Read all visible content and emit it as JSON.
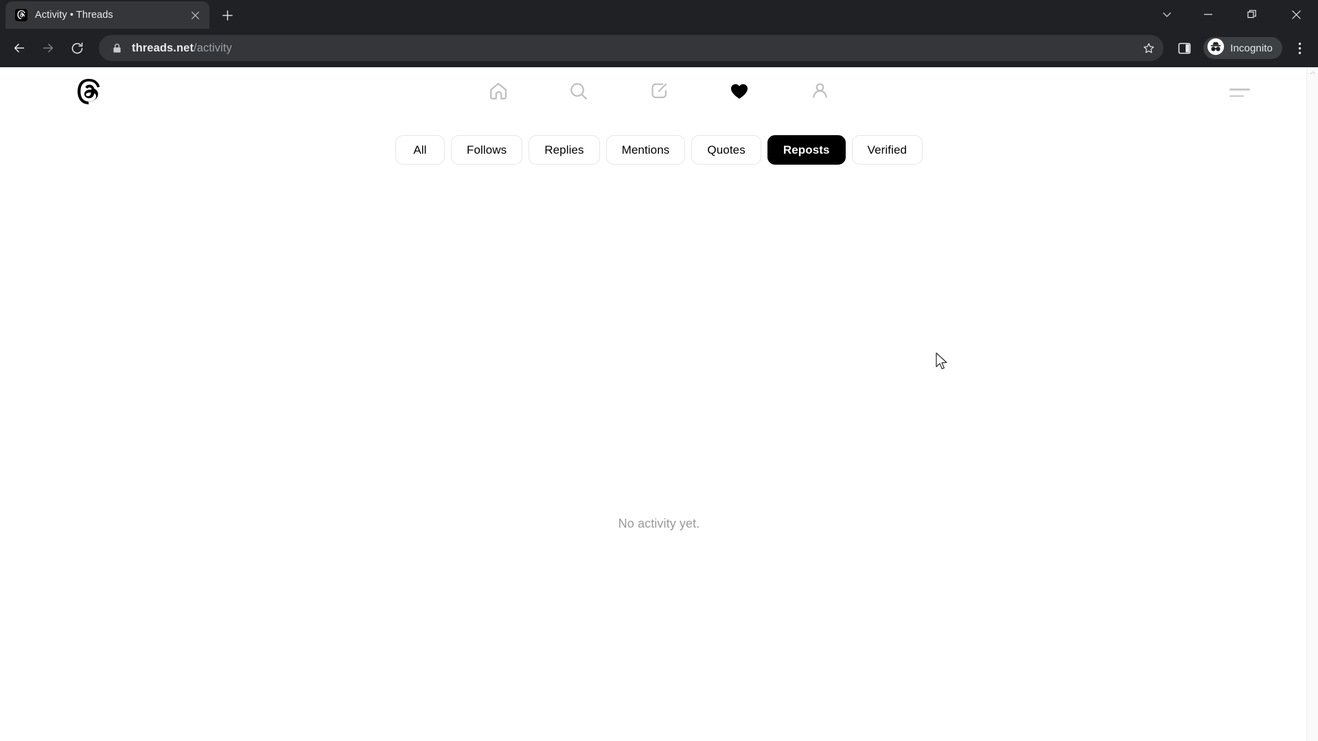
{
  "browser": {
    "tab": {
      "title": "Activity • Threads",
      "favicon_icon": "threads-logo-icon",
      "close_icon": "close-icon"
    },
    "new_tab_icon": "plus-icon",
    "window_controls": [
      {
        "name": "tab-search",
        "icon": "chevron-down-icon"
      },
      {
        "name": "minimize",
        "icon": "minimize-icon"
      },
      {
        "name": "maximize",
        "icon": "restore-icon"
      },
      {
        "name": "close",
        "icon": "close-icon"
      }
    ],
    "toolbar": {
      "back_icon": "arrow-left-icon",
      "forward_icon": "arrow-right-icon",
      "reload_icon": "reload-icon",
      "lock_icon": "lock-icon",
      "url_domain": "threads.net",
      "url_path": "/activity",
      "url_full": "threads.net/activity",
      "bookmark_icon": "star-icon",
      "side_panel_icon": "side-panel-icon",
      "profile_label": "Incognito",
      "profile_icon": "incognito-icon",
      "menu_icon": "kebab-menu-icon"
    }
  },
  "page": {
    "logo_icon": "threads-logo-icon",
    "nav": [
      {
        "name": "home",
        "icon": "home-icon",
        "active": false
      },
      {
        "name": "search",
        "icon": "search-icon",
        "active": false
      },
      {
        "name": "compose",
        "icon": "compose-icon",
        "active": false
      },
      {
        "name": "activity",
        "icon": "heart-icon",
        "active": true
      },
      {
        "name": "profile",
        "icon": "person-icon",
        "active": false
      }
    ],
    "menu_icon": "hamburger-menu-icon",
    "filters": [
      {
        "label": "All",
        "active": false
      },
      {
        "label": "Follows",
        "active": false
      },
      {
        "label": "Replies",
        "active": false
      },
      {
        "label": "Mentions",
        "active": false
      },
      {
        "label": "Quotes",
        "active": false
      },
      {
        "label": "Reposts",
        "active": true
      },
      {
        "label": "Verified",
        "active": false
      }
    ],
    "empty_state": "No activity yet."
  },
  "colors": {
    "chrome_bg": "#202124",
    "tab_active_bg": "#35363a",
    "page_bg": "#ffffff",
    "accent_active_pill": "#000000",
    "muted_text": "#999999",
    "pill_border": "#e6e6e6"
  }
}
